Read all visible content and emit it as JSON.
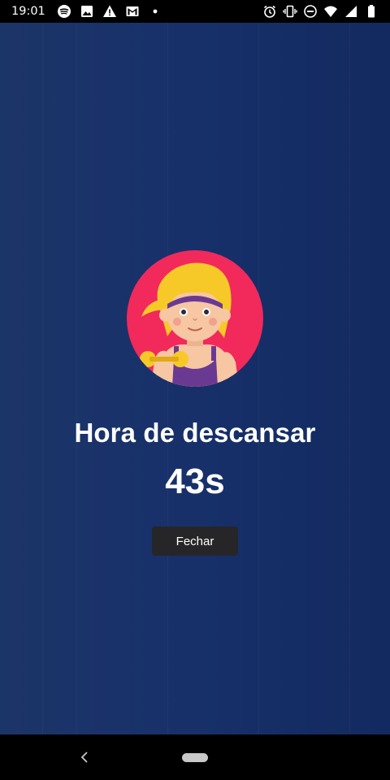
{
  "status_bar": {
    "time": "19:01",
    "left_icons": [
      "spotify-icon",
      "image-icon",
      "warning-icon",
      "gmail-icon",
      "dot-icon"
    ],
    "right_icons": [
      "alarm-icon",
      "vibrate-icon",
      "dnd-icon",
      "wifi-icon",
      "signal-icon",
      "battery-icon"
    ]
  },
  "rest_screen": {
    "title": "Hora de descansar",
    "timer": "43s",
    "close_label": "Fechar",
    "background_color": "#17306a",
    "avatar_bg_color": "#f2295b"
  },
  "nav_bar": {
    "icons": [
      "back-icon",
      "home-pill"
    ]
  }
}
